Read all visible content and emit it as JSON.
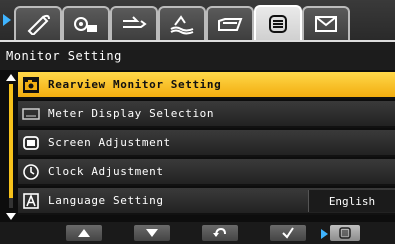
{
  "tabs": [
    {
      "icon": "pen-icon"
    },
    {
      "icon": "camera-settings-icon"
    },
    {
      "icon": "flash-icon"
    },
    {
      "icon": "scene-icon"
    },
    {
      "icon": "folder-icon"
    },
    {
      "icon": "menu-list-icon",
      "active": true
    },
    {
      "icon": "mail-icon"
    }
  ],
  "header": {
    "title": "Monitor Setting"
  },
  "menu": {
    "items": [
      {
        "label": "Rearview Monitor Setting",
        "icon": "camera-monitor-icon",
        "selected": true
      },
      {
        "label": "Meter Display Selection",
        "icon": "meter-icon"
      },
      {
        "label": "Screen Adjustment",
        "icon": "screen-icon"
      },
      {
        "label": "Clock Adjustment",
        "icon": "clock-icon"
      },
      {
        "label": "Language Setting",
        "icon": "language-icon",
        "value": "English"
      }
    ]
  },
  "bottom": {
    "buttons": [
      {
        "icon": "up-arrow-icon"
      },
      {
        "icon": "down-arrow-icon"
      },
      {
        "icon": "back-icon"
      },
      {
        "icon": "check-icon"
      },
      {
        "icon": "menu-list-icon"
      }
    ]
  },
  "colors": {
    "accent": "#f7c21b",
    "indicator": "#3fb4ff"
  }
}
